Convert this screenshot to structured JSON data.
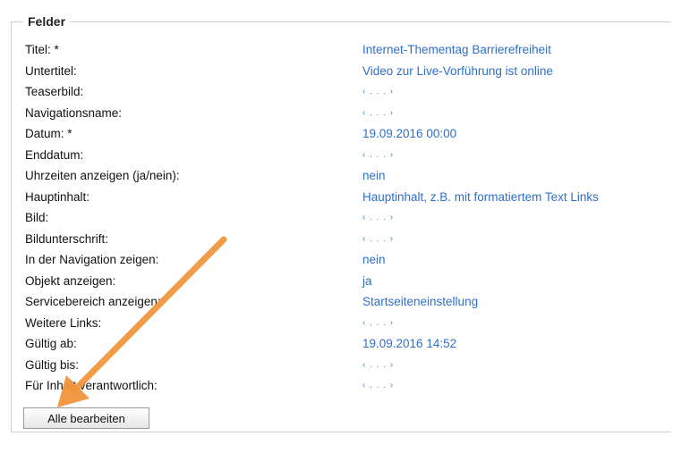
{
  "fieldset": {
    "legend": "Felder"
  },
  "fields": [
    {
      "label": "Titel: *",
      "value": "Internet-Thementag Barrierefreiheit",
      "empty": false
    },
    {
      "label": "Untertitel:",
      "value": "Video zur Live-Vorführung ist online",
      "empty": false
    },
    {
      "label": "Teaserbild:",
      "value": "‹ . . . ›",
      "empty": true
    },
    {
      "label": "Navigationsname:",
      "value": "‹ . . . ›",
      "empty": true
    },
    {
      "label": "Datum: *",
      "value": "19.09.2016 00:00",
      "empty": false
    },
    {
      "label": "Enddatum:",
      "value": "‹ . . . ›",
      "empty": true
    },
    {
      "label": "Uhrzeiten anzeigen (ja/nein):",
      "value": "nein",
      "empty": false
    },
    {
      "label": "Hauptinhalt:",
      "value": "Hauptinhalt, z.B. mit formatiertem Text Links",
      "empty": false
    },
    {
      "label": "Bild:",
      "value": "‹ . . . ›",
      "empty": true
    },
    {
      "label": "Bildunterschrift:",
      "value": "‹ . . . ›",
      "empty": true
    },
    {
      "label": "In der Navigation zeigen:",
      "value": "nein",
      "empty": false
    },
    {
      "label": "Objekt anzeigen:",
      "value": "ja",
      "empty": false
    },
    {
      "label": "Servicebereich anzeigen:",
      "value": "Startseiteneinstellung",
      "empty": false
    },
    {
      "label": "Weitere Links:",
      "value": "‹ . . . ›",
      "empty": true
    },
    {
      "label": "Gültig ab:",
      "value": "19.09.2016 14:52",
      "empty": false
    },
    {
      "label": "Gültig bis:",
      "value": "‹ . . . ›",
      "empty": true
    },
    {
      "label": "Für Inhalt verantwortlich:",
      "value": "‹ . . . ›",
      "empty": true
    }
  ],
  "actions": {
    "edit_all_label": "Alle bearbeiten"
  },
  "colors": {
    "link": "#2f6fc9",
    "arrow": "#f0943a"
  }
}
